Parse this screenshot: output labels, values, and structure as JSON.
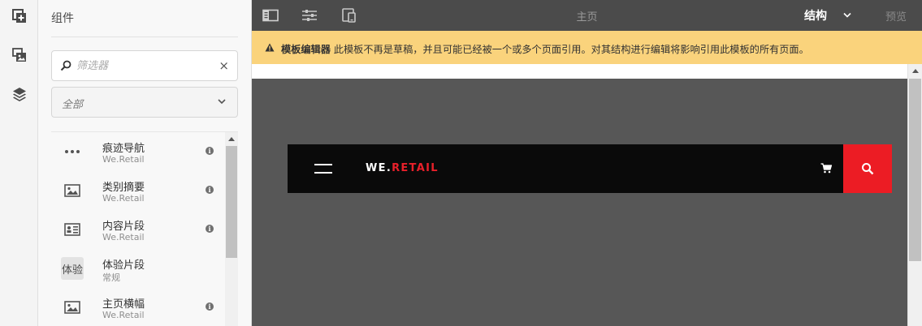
{
  "rail": {
    "items": [
      {
        "icon": "add-component-icon"
      },
      {
        "icon": "assets-icon"
      },
      {
        "icon": "layers-icon"
      }
    ]
  },
  "panel": {
    "title": "组件",
    "search": {
      "placeholder": "筛选器",
      "value": "",
      "clear_glyph": "×"
    },
    "group_filter": {
      "selected": "全部"
    },
    "components": [
      {
        "name": "痕迹导航",
        "group": "We.Retail",
        "icon": "more-dots-icon",
        "has_info": true
      },
      {
        "name": "类别摘要",
        "group": "We.Retail",
        "icon": "image-icon",
        "has_info": true
      },
      {
        "name": "内容片段",
        "group": "We.Retail",
        "icon": "content-fragment-icon",
        "has_info": true
      },
      {
        "name": "体验片段",
        "group": "常规",
        "icon_text": "体验",
        "has_info": false
      },
      {
        "name": "主页横幅",
        "group": "We.Retail",
        "icon": "image-icon",
        "has_info": true
      }
    ],
    "info_glyph": "i"
  },
  "toolbar": {
    "page_title": "主页",
    "mode": "结构",
    "preview": "预览"
  },
  "banner": {
    "strong": "模板编辑器",
    "message": " 此模板不再是草稿，并且可能已经被一个或多个页面引用。对其结构进行编辑将影响引用此模板的所有页面。"
  },
  "site": {
    "brand_we": "WE.",
    "brand_retail": "RETAIL"
  },
  "colors": {
    "toolbar_bg": "#4b4b4b",
    "banner_bg": "#fad37c",
    "canvas_bg": "#575757",
    "header_bg": "#0a0a0a",
    "accent_red": "#ec1c24"
  }
}
